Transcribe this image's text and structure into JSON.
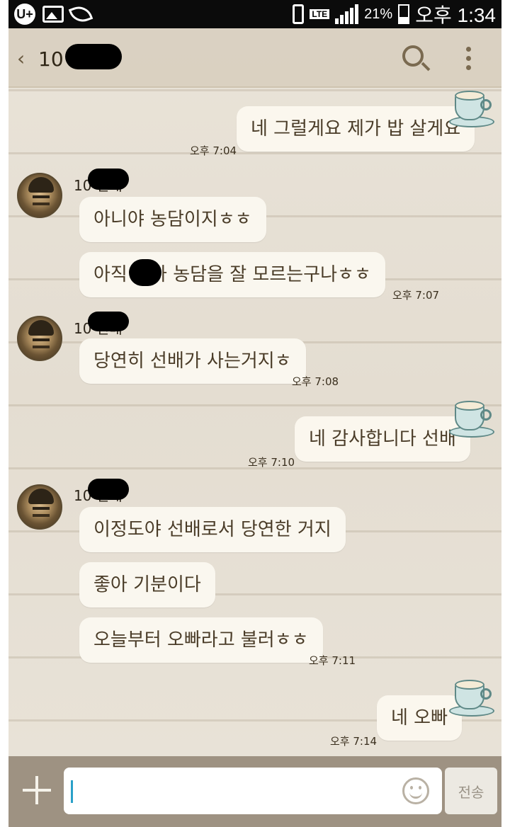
{
  "status_bar": {
    "carrier_icon": "U+",
    "network": "LTE",
    "battery_percent": "21%",
    "time": "오후 1:34"
  },
  "header": {
    "back_icon": "‹",
    "title": "10 선배"
  },
  "messages": [
    {
      "direction": "out",
      "text": "네 그럴게요 제가 밥 살게요",
      "time": "오후 7:04"
    },
    {
      "direction": "in",
      "sender": "10 선배",
      "text": "아니야 농담이지ㅎㅎ",
      "time": ""
    },
    {
      "direction": "in",
      "text": "아직 이가 농담을 잘 모르는구나ㅎㅎ",
      "time": "오후 7:07"
    },
    {
      "direction": "in",
      "sender": "10 선배",
      "text": "당연히 선배가 사는거지ㅎ",
      "time": "오후 7:08"
    },
    {
      "direction": "out",
      "text": "네 감사합니다 선배",
      "time": "오후 7:10"
    },
    {
      "direction": "in",
      "sender": "10 선배",
      "text": "이정도야 선배로서 당연한 거지",
      "time": ""
    },
    {
      "direction": "in",
      "text": "좋아 기분이다",
      "time": ""
    },
    {
      "direction": "in",
      "text": "오늘부터 오빠라고 불러ㅎㅎ",
      "time": "오후 7:11"
    },
    {
      "direction": "out",
      "text": "네 오빠",
      "time": "오후 7:14"
    }
  ],
  "input": {
    "value": "",
    "send_label": "전송"
  },
  "colors": {
    "header_bg": "#d7cebe",
    "bubble_bg": "#faf7ef",
    "input_bar_bg": "#9e9282",
    "text": "#4a3c28"
  },
  "icons": [
    "back-icon",
    "search-icon",
    "more-options-icon",
    "teacup-icon",
    "plus-icon",
    "emoji-icon"
  ]
}
